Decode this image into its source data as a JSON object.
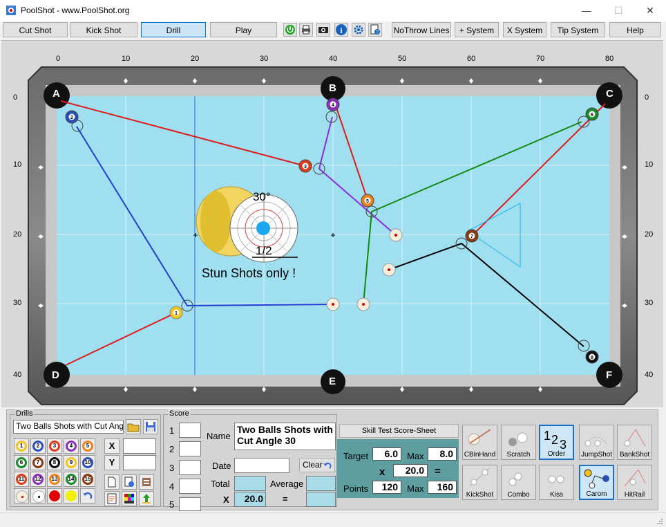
{
  "window": {
    "title": "PoolShot - www.PoolShot.org",
    "minimize": "—",
    "maximize": "☐",
    "close": "✕"
  },
  "toolbar": {
    "cut_shot": "Cut Shot",
    "kick_shot": "Kick Shot",
    "drill": "Drill",
    "play": "Play",
    "no_throw_lines": "NoThrow Lines",
    "plus_system": "+ System",
    "x_system": "X System",
    "tip_system": "Tip System",
    "help": "Help"
  },
  "table": {
    "top_ruler": [
      "0",
      "10",
      "20",
      "30",
      "40",
      "50",
      "60",
      "70",
      "80"
    ],
    "side_ruler": [
      "0",
      "10",
      "20",
      "30",
      "40"
    ],
    "pockets": [
      "A",
      "B",
      "C",
      "D",
      "E",
      "F"
    ],
    "cut_angle": "30°",
    "fraction": "1/2",
    "note": "Stun Shots only !",
    "balls": [
      "1",
      "2",
      "3",
      "4",
      "5",
      "6",
      "7",
      "8"
    ]
  },
  "drills": {
    "group_label": "Drills",
    "selected": "Two Balls Shots with Cut Angle 30",
    "x_label": "X",
    "y_label": "Y",
    "ball_buttons": [
      "1",
      "2",
      "3",
      "4",
      "5",
      "6",
      "7",
      "8",
      "9",
      "10",
      "11",
      "12",
      "13",
      "14",
      "15"
    ]
  },
  "score": {
    "group_label": "Score",
    "rows": [
      "1",
      "2",
      "3",
      "4",
      "5"
    ],
    "name_label": "Name",
    "name_value": "Two Balls Shots with Cut Angle 30",
    "date_label": "Date",
    "clear_label": "Clear",
    "total_label": "Total",
    "average_label": "Average",
    "x_label": "X",
    "multiplier": "20.0",
    "equals": "="
  },
  "skill_test": {
    "title": "Skill Test Score-Sheet",
    "target_label": "Target",
    "target": "6.0",
    "max_label": "Max",
    "max": "8.0",
    "x_label": "x",
    "multiplier": "20.0",
    "equals": "=",
    "points_label": "Points",
    "points": "120",
    "points_max_label": "Max",
    "points_max": "160"
  },
  "shot_types": [
    "CBinHand",
    "Scratch",
    "Order",
    "JumpShot",
    "BankShot",
    "KickShot",
    "Combo",
    "Kiss",
    "Carom",
    "HitRail"
  ]
}
